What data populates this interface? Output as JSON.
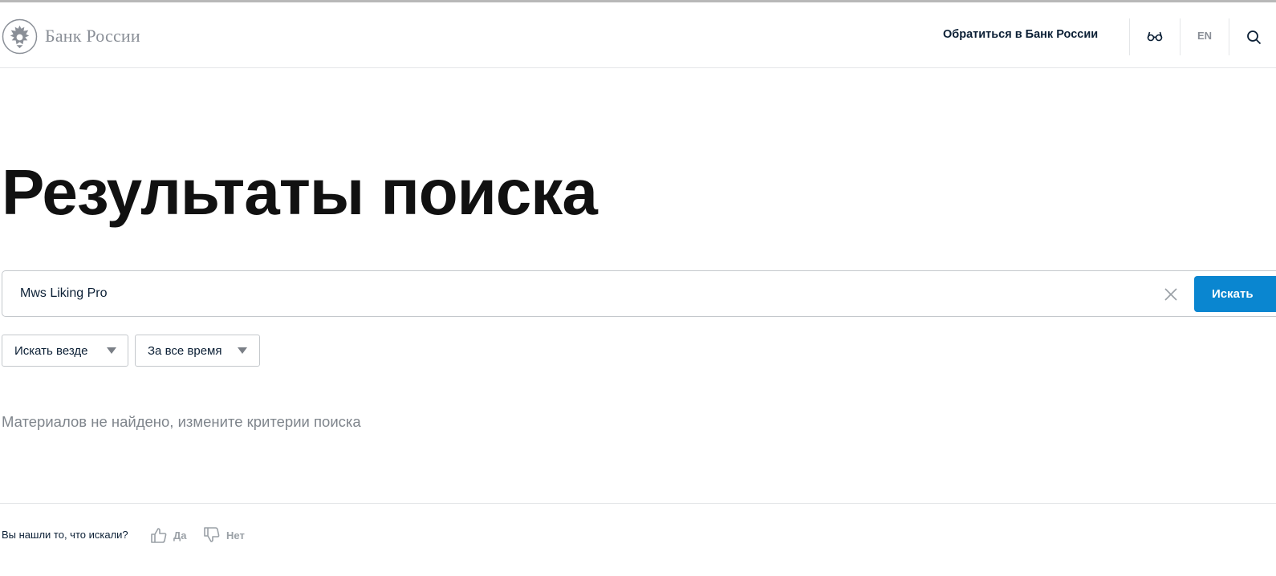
{
  "header": {
    "logo_text": "Банк России",
    "contact_link": "Обратиться в Банк России",
    "lang": "EN"
  },
  "main": {
    "title": "Результаты поиска",
    "search": {
      "value": "Mws Liking Pro",
      "submit_label": "Искать"
    },
    "filters": [
      {
        "label": "Искать везде"
      },
      {
        "label": "За все время"
      }
    ],
    "empty_message": "Материалов не найдено, измените критерии поиска"
  },
  "feedback": {
    "question": "Вы нашли то, что искали?",
    "yes_label": "Да",
    "no_label": "Нет"
  },
  "colors": {
    "accent": "#0a86d0",
    "text": "#0b1f35",
    "muted": "#8a8f97"
  },
  "icons": [
    "bank-emblem-icon",
    "glasses-icon",
    "search-icon",
    "close-icon",
    "dropdown-arrow-icon",
    "thumbs-up-icon",
    "thumbs-down-icon"
  ]
}
